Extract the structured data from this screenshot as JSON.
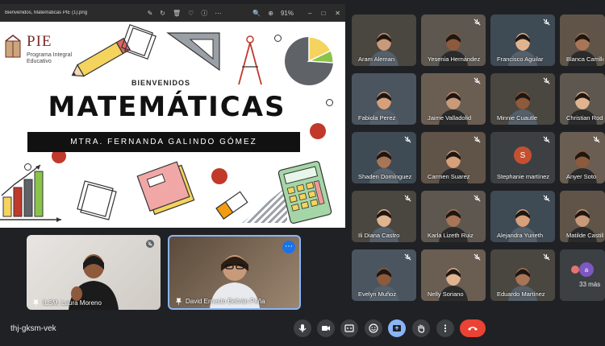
{
  "viewer": {
    "filename": "Bienvenidos, Matemáticas PIE (1).png",
    "zoom": "91%"
  },
  "slide": {
    "logo_title": "PIE",
    "logo_sub_1": "Programa Integral",
    "logo_sub_2": "Educativo",
    "welcome": "BIENVENIDOS",
    "title": "MATEMÁTICAS",
    "teacher": "MTRA. FERNANDA GALINDO GÓMEZ"
  },
  "pinned": [
    {
      "name": "ILSM. Laura Moreno"
    },
    {
      "name": "David Ernesto Beltrán Peña"
    }
  ],
  "grid": [
    {
      "name": "Aram Aleman",
      "muted": false
    },
    {
      "name": "Yesenia Hernández",
      "muted": true
    },
    {
      "name": "Francisco Aguilar",
      "muted": true
    },
    {
      "name": "Blanca Carrillo",
      "muted": false
    },
    {
      "name": "Fabiola Perez",
      "muted": false
    },
    {
      "name": "Jaime Valladolid",
      "muted": true
    },
    {
      "name": "Minnie Cuautle",
      "muted": true
    },
    {
      "name": "Christian Rodríguez",
      "muted": false
    },
    {
      "name": "Shaden Domínguez",
      "muted": true
    },
    {
      "name": "Carmen Suarez",
      "muted": true
    },
    {
      "name": "Stephanie martínez",
      "muted": true,
      "initial": "S"
    },
    {
      "name": "Anyer Soto",
      "muted": true
    },
    {
      "name": "Ili Diana Castro",
      "muted": true
    },
    {
      "name": "Karla Lizeth Ruiz",
      "muted": true
    },
    {
      "name": "Alejandra Yurieth",
      "muted": true
    },
    {
      "name": "Matilde Castillo",
      "muted": false
    },
    {
      "name": "Evelyn Muñoz",
      "muted": true
    },
    {
      "name": "Nelly Soriano",
      "muted": true
    },
    {
      "name": "Eduardo Martínez",
      "muted": true
    }
  ],
  "more": {
    "label": "33 más",
    "avatar": "a"
  },
  "meeting": {
    "code": "thj-gksm-vek"
  },
  "colors": {
    "background": "#202124",
    "tile": "#3c4043",
    "end_call": "#ea4335",
    "active_border": "#8ab4f8",
    "accent": "#1a73e8"
  }
}
